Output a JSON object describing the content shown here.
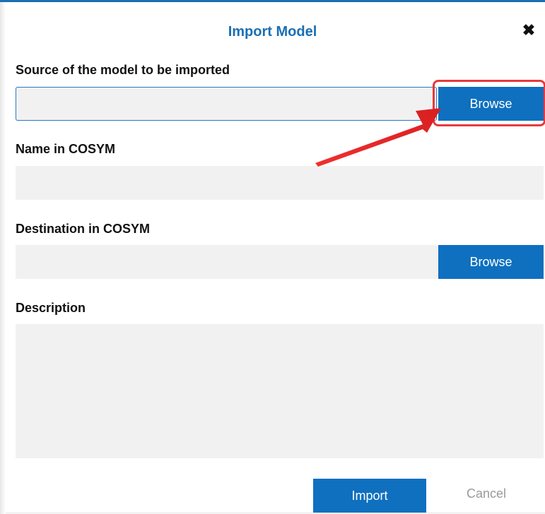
{
  "dialog": {
    "title": "Import Model",
    "close_icon": "close-icon"
  },
  "source": {
    "label": "Source of the model to be imported",
    "value": "",
    "browse_label": "Browse"
  },
  "name_field": {
    "label": "Name in COSYM",
    "value": ""
  },
  "destination": {
    "label": "Destination in COSYM",
    "value": "",
    "browse_label": "Browse"
  },
  "description": {
    "label": "Description",
    "value": ""
  },
  "footer": {
    "import_label": "Import",
    "cancel_label": "Cancel"
  },
  "annotation": {
    "highlight_color": "#e8393b",
    "arrow_icon": "red-arrow-icon"
  },
  "colors": {
    "accent": "#1b6fb3",
    "button": "#0f70bf",
    "field_bg": "#f1f1f1"
  }
}
